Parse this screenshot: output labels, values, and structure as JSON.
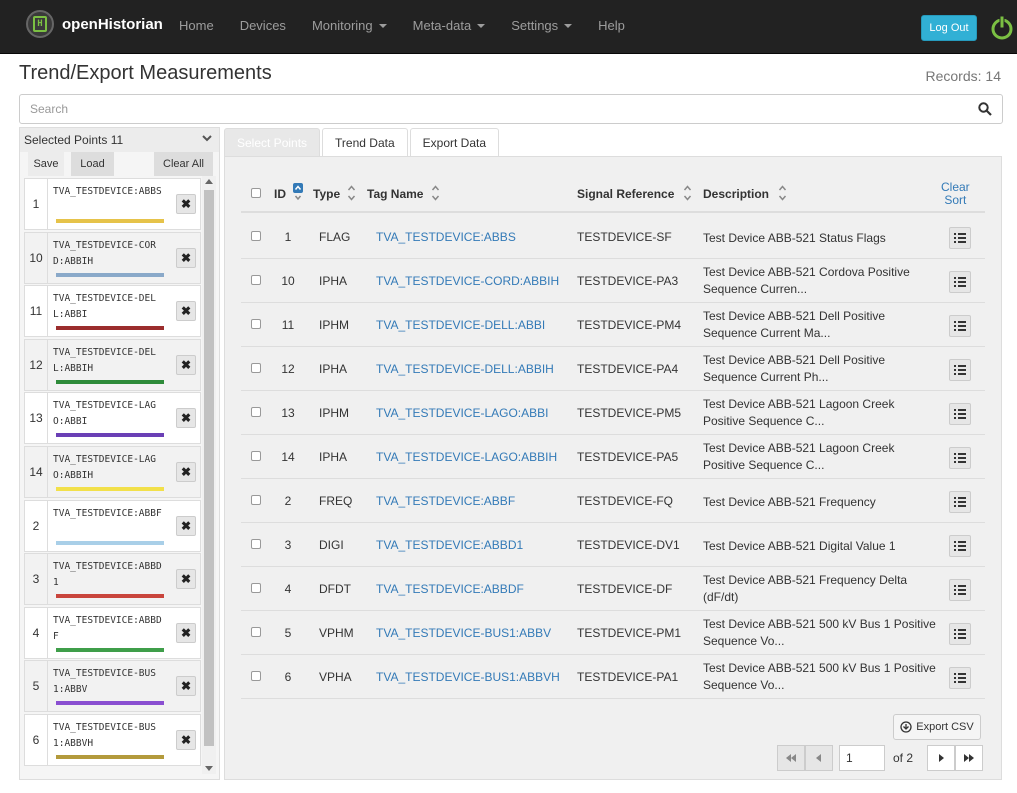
{
  "app": {
    "brand": "openHistorian"
  },
  "nav": {
    "home": "Home",
    "devices": "Devices",
    "monitoring": "Monitoring",
    "metadata": "Meta-data",
    "settings": "Settings",
    "help": "Help",
    "logout": "Log Out"
  },
  "page": {
    "title": "Trend/Export Measurements",
    "records_label": "Records:",
    "records_count": "14"
  },
  "search": {
    "placeholder": "Search"
  },
  "selected": {
    "header": "Selected Points 11",
    "save": "Save",
    "load": "Load",
    "clear_all": "Clear All",
    "points": [
      {
        "id": "1",
        "tag": "TVA_TESTDEVICE:ABBS",
        "color": "#e6c34a"
      },
      {
        "id": "10",
        "tag": "TVA_TESTDEVICE-CORD:ABBIH",
        "color": "#8aa9c9"
      },
      {
        "id": "11",
        "tag": "TVA_TESTDEVICE-DELL:ABBI",
        "color": "#9b2d2d"
      },
      {
        "id": "12",
        "tag": "TVA_TESTDEVICE-DELL:ABBIH",
        "color": "#2e8b3a"
      },
      {
        "id": "13",
        "tag": "TVA_TESTDEVICE-LAGO:ABBI",
        "color": "#6a3fb5"
      },
      {
        "id": "14",
        "tag": "TVA_TESTDEVICE-LAGO:ABBIH",
        "color": "#f2e04a"
      },
      {
        "id": "2",
        "tag": "TVA_TESTDEVICE:ABBF",
        "color": "#a9cfe8"
      },
      {
        "id": "3",
        "tag": "TVA_TESTDEVICE:ABBD1",
        "color": "#c9453c"
      },
      {
        "id": "4",
        "tag": "TVA_TESTDEVICE:ABBDF",
        "color": "#3f9e4a"
      },
      {
        "id": "5",
        "tag": "TVA_TESTDEVICE-BUS1:ABBV",
        "color": "#8a4fd1"
      },
      {
        "id": "6",
        "tag": "TVA_TESTDEVICE-BUS1:ABBVH",
        "color": "#b39a3c"
      }
    ]
  },
  "tabs": {
    "select": "Select Points",
    "trend": "Trend Data",
    "export": "Export Data"
  },
  "table": {
    "headers": {
      "id": "ID",
      "type": "Type",
      "tag": "Tag Name",
      "signal": "Signal Reference",
      "desc": "Description"
    },
    "clear_sort_1": "Clear",
    "clear_sort_2": "Sort",
    "rows": [
      {
        "id": "1",
        "type": "FLAG",
        "tag": "TVA_TESTDEVICE:ABBS",
        "signal": "TESTDEVICE-SF",
        "desc": "Test Device ABB-521 Status Flags"
      },
      {
        "id": "10",
        "type": "IPHA",
        "tag": "TVA_TESTDEVICE-CORD:ABBIH",
        "signal": "TESTDEVICE-PA3",
        "desc": "Test Device ABB-521 Cordova Positive Sequence Curren..."
      },
      {
        "id": "11",
        "type": "IPHM",
        "tag": "TVA_TESTDEVICE-DELL:ABBI",
        "signal": "TESTDEVICE-PM4",
        "desc": "Test Device ABB-521 Dell Positive Sequence Current Ma..."
      },
      {
        "id": "12",
        "type": "IPHA",
        "tag": "TVA_TESTDEVICE-DELL:ABBIH",
        "signal": "TESTDEVICE-PA4",
        "desc": "Test Device ABB-521 Dell Positive Sequence Current Ph..."
      },
      {
        "id": "13",
        "type": "IPHM",
        "tag": "TVA_TESTDEVICE-LAGO:ABBI",
        "signal": "TESTDEVICE-PM5",
        "desc": "Test Device ABB-521 Lagoon Creek Positive Sequence C..."
      },
      {
        "id": "14",
        "type": "IPHA",
        "tag": "TVA_TESTDEVICE-LAGO:ABBIH",
        "signal": "TESTDEVICE-PA5",
        "desc": "Test Device ABB-521 Lagoon Creek Positive Sequence C..."
      },
      {
        "id": "2",
        "type": "FREQ",
        "tag": "TVA_TESTDEVICE:ABBF",
        "signal": "TESTDEVICE-FQ",
        "desc": "Test Device ABB-521 Frequency"
      },
      {
        "id": "3",
        "type": "DIGI",
        "tag": "TVA_TESTDEVICE:ABBD1",
        "signal": "TESTDEVICE-DV1",
        "desc": "Test Device ABB-521 Digital Value 1"
      },
      {
        "id": "4",
        "type": "DFDT",
        "tag": "TVA_TESTDEVICE:ABBDF",
        "signal": "TESTDEVICE-DF",
        "desc": "Test Device ABB-521 Frequency Delta (dF/dt)"
      },
      {
        "id": "5",
        "type": "VPHM",
        "tag": "TVA_TESTDEVICE-BUS1:ABBV",
        "signal": "TESTDEVICE-PM1",
        "desc": "Test Device ABB-521 500 kV Bus 1 Positive Sequence Vo..."
      },
      {
        "id": "6",
        "type": "VPHA",
        "tag": "TVA_TESTDEVICE-BUS1:ABBVH",
        "signal": "TESTDEVICE-PA1",
        "desc": "Test Device ABB-521 500 kV Bus 1 Positive Sequence Vo..."
      }
    ]
  },
  "export": {
    "label": "Export CSV"
  },
  "pager": {
    "page": "1",
    "of_label": "of 2"
  }
}
